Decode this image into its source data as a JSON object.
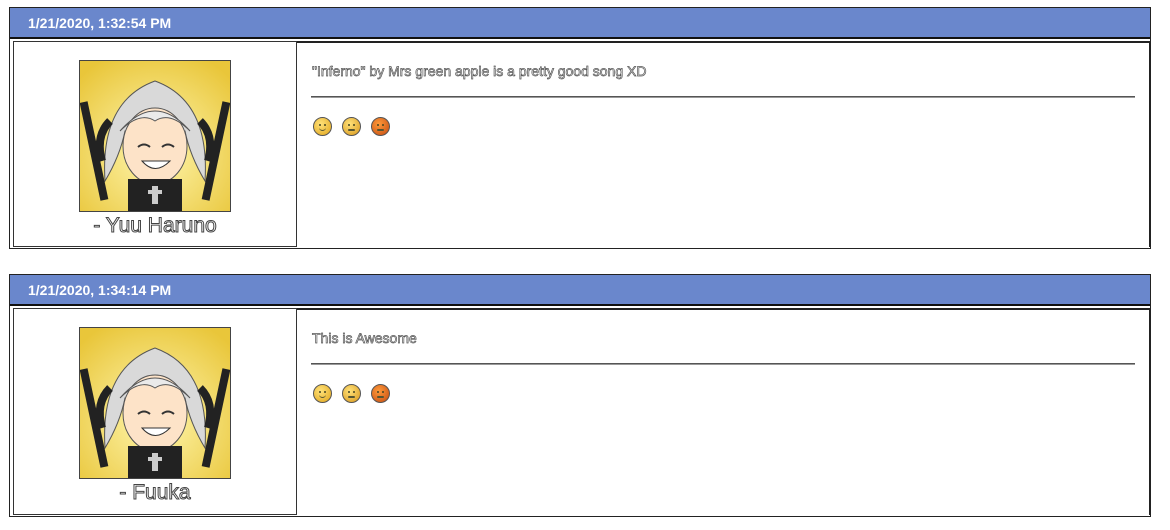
{
  "posts": [
    {
      "timestamp": "1/21/2020, 1:32:54 PM",
      "author": "- Yuu Haruno",
      "message": "\"Inferno\" by Mrs green apple is a pretty good song XD",
      "avatar_icon": "anime-avatar",
      "reactions": [
        "smile-reaction-icon",
        "neutral-reaction-icon",
        "angry-reaction-icon"
      ]
    },
    {
      "timestamp": "1/21/2020, 1:34:14 PM",
      "author": "- Fuuka",
      "message": "This is Awesome",
      "avatar_icon": "anime-avatar",
      "reactions": [
        "smile-reaction-icon",
        "neutral-reaction-icon",
        "angry-reaction-icon"
      ]
    }
  ],
  "colors": {
    "header": "#6a87cc",
    "header_text": "#ffffff"
  }
}
